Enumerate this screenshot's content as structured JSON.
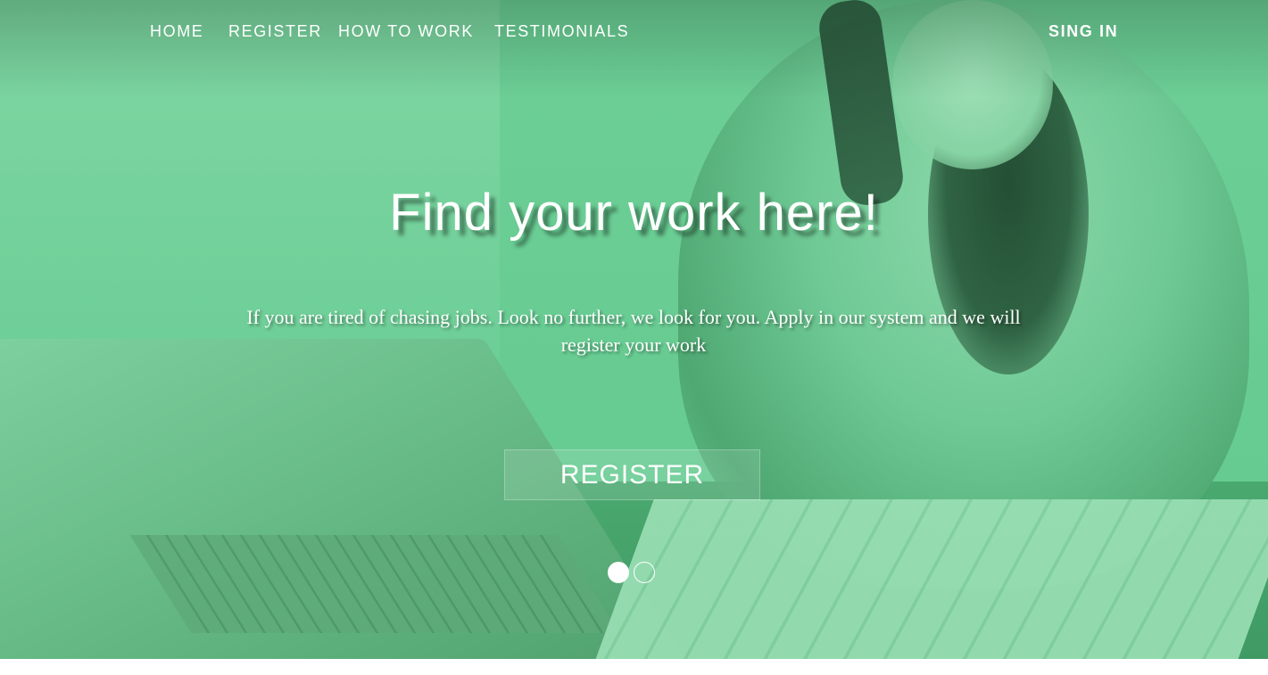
{
  "nav": {
    "items": [
      {
        "label": "HOME"
      },
      {
        "label": "REGISTER"
      },
      {
        "label": "HOW TO WORK"
      },
      {
        "label": "TESTIMONIALS"
      }
    ],
    "signin_label": "SING IN"
  },
  "hero": {
    "title": "Find your work here!",
    "subtitle": "If you are tired of chasing jobs. Look no further, we look for you. Apply in our system and we will register your work",
    "button_label": "REGISTER",
    "slides": {
      "count": 2,
      "active_index": 0
    }
  },
  "colors": {
    "overlay_tint": "#5fc98a",
    "text": "#ffffff",
    "page_background": "#ffffff"
  }
}
